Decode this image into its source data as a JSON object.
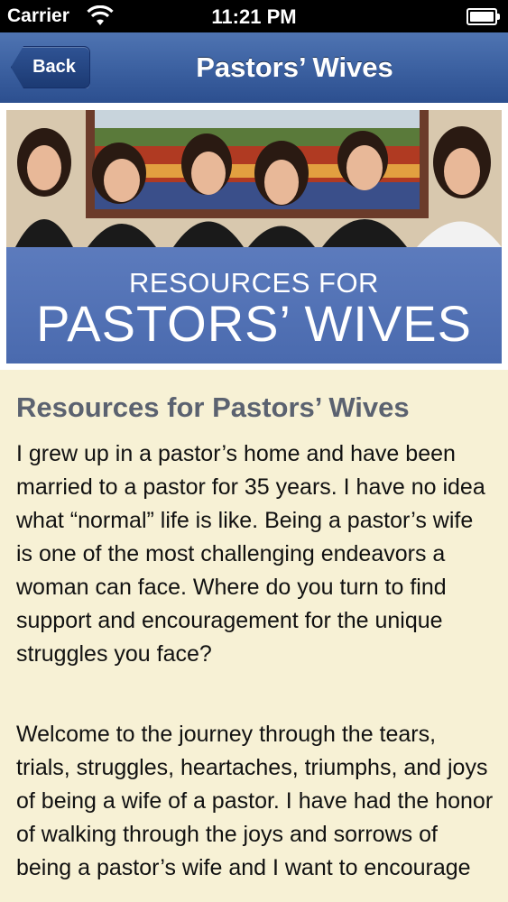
{
  "status_bar": {
    "carrier": "Carrier",
    "time": "11:21 PM",
    "wifi_icon": "wifi-icon",
    "battery_icon": "battery-icon"
  },
  "nav": {
    "back_label": "Back",
    "title": "Pastors’ Wives"
  },
  "banner": {
    "line1": "RESOURCES FOR",
    "line2": "PASTORS’ WIVES",
    "photo_description_icon": "group-photo-image"
  },
  "article": {
    "heading": "Resources for Pastors’ Wives",
    "paragraphs": [
      "I grew up in a pastor’s home and have been married to a pastor for 35 years. I have no idea what “normal” life is like. Being a pastor’s wife is one of the most challenging endeavors a woman can face. Where do you turn to find support and encouragement for the unique struggles you face?",
      "Welcome to the journey through the tears, trials, struggles, heartaches, triumphs, and joys of being a wife of a pastor. I have had the honor of walking through the joys and sorrows of being a pastor’s wife and I want to encourage"
    ]
  },
  "colors": {
    "nav_blue": "#3e63a3",
    "banner_blue": "#5270b3",
    "page_bg": "#f7f1d5",
    "heading_gray": "#5b6270"
  }
}
